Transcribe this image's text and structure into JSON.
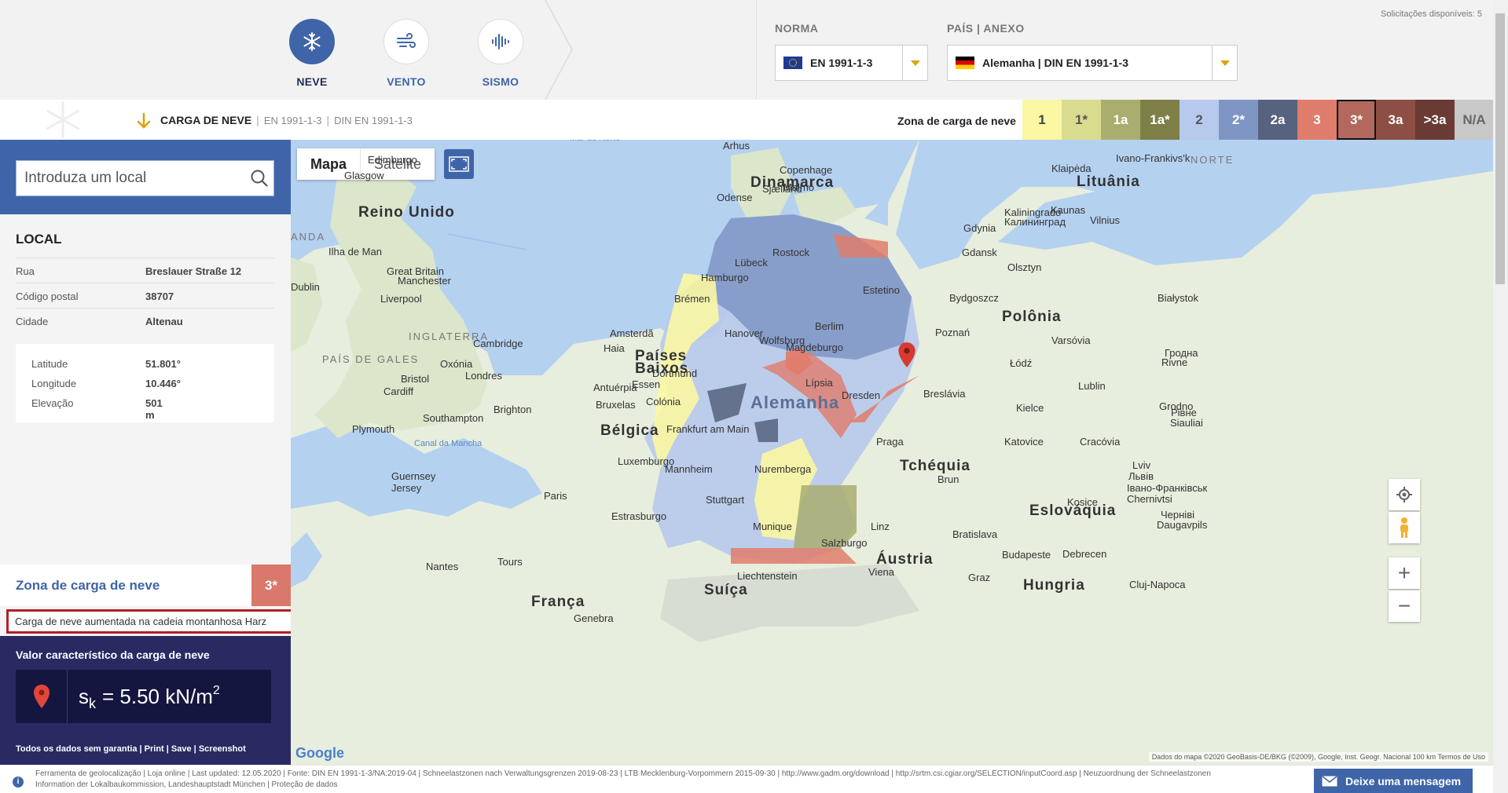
{
  "header": {
    "modes": [
      {
        "label": "NEVE",
        "icon": "snowflake-icon",
        "active": true
      },
      {
        "label": "VENTO",
        "icon": "wind-icon",
        "active": false
      },
      {
        "label": "SISMO",
        "icon": "seismic-icon",
        "active": false
      }
    ],
    "norma": {
      "label": "NORMA",
      "value": "EN 1991-1-3",
      "flag": "eu-flag-icon"
    },
    "pais": {
      "label": "PAÍS | ANEXO",
      "value": "Alemanha | DIN EN 1991-1-3",
      "flag": "germany-flag-icon"
    },
    "requests": "Solicitações disponíveis: 5"
  },
  "subheader": {
    "title": "CARGA DE NEVE",
    "std1": "EN 1991-1-3",
    "std2": "DIN EN 1991-1-3",
    "legend_title": "Zona de carga de neve",
    "zones": [
      {
        "label": "1",
        "color": "#fbf7a3",
        "text": "#444"
      },
      {
        "label": "1*",
        "color": "#d9dc8e",
        "text": "#555"
      },
      {
        "label": "1a",
        "color": "#a9ad6e",
        "text": "#fff"
      },
      {
        "label": "1a*",
        "color": "#7d7f47",
        "text": "#fff"
      },
      {
        "label": "2",
        "color": "#b7c9ec",
        "text": "#555"
      },
      {
        "label": "2*",
        "color": "#7f95c4",
        "text": "#fff"
      },
      {
        "label": "2a",
        "color": "#56627e",
        "text": "#fff"
      },
      {
        "label": "3",
        "color": "#e07c6b",
        "text": "#fff"
      },
      {
        "label": "3*",
        "color": "#b2685c",
        "text": "#fff",
        "selected": true
      },
      {
        "label": "3a",
        "color": "#8d4f45",
        "text": "#fff"
      },
      {
        "label": ">3a",
        "color": "#6a3b35",
        "text": "#fff"
      },
      {
        "label": "N/A",
        "color": "#c8c8c8",
        "text": "#666"
      }
    ]
  },
  "sidebar": {
    "search_placeholder": "Introduza um local",
    "local_title": "LOCAL",
    "address": [
      {
        "k": "Rua",
        "v": "Breslauer Straße 12"
      },
      {
        "k": "Código postal",
        "v": "38707"
      },
      {
        "k": "Cidade",
        "v": "Altenau"
      }
    ],
    "geo": [
      {
        "k": "Latitude",
        "v": "51.801°"
      },
      {
        "k": "Longitude",
        "v": "10.446°"
      },
      {
        "k": "Elevação",
        "v": "501 m"
      }
    ],
    "zone_label": "Zona de carga de neve",
    "zone_value": "3*",
    "zone_note": "Carga de neve aumentada na cadeia montanhosa Harz",
    "value_title": "Valor característico da carga de neve",
    "value_symbol": "s",
    "value_sub": "k",
    "value_text": "= 5.50 kN/m",
    "value_sup": "2",
    "links": {
      "prefix": "Todos os dados sem garantia",
      "print": "Print",
      "save": "Save",
      "screenshot": "Screenshot"
    }
  },
  "map": {
    "tab_map": "Mapa",
    "tab_sat": "Satélite",
    "google": "Google",
    "attribution": "Dados do mapa ©2020 GeoBasis-DE/BKG (©2009), Google, Inst. Geogr. Nacional   100 km   Termos de Uso",
    "labels": [
      {
        "t": "Mar do Norte",
        "c": "sea"
      },
      {
        "t": "Dinamarca",
        "c": "country"
      },
      {
        "t": "Reino Unido",
        "c": "country"
      },
      {
        "t": "Países",
        "c": "country"
      },
      {
        "t": "Baixos",
        "c": "country"
      },
      {
        "t": "Bélgica",
        "c": "country"
      },
      {
        "t": "Alemanha",
        "c": "country big"
      },
      {
        "t": "Polônia",
        "c": "country"
      },
      {
        "t": "Lituânia",
        "c": "country"
      },
      {
        "t": "Tchéquia",
        "c": "country"
      },
      {
        "t": "Eslováquia",
        "c": "country"
      },
      {
        "t": "Áustria",
        "c": "country"
      },
      {
        "t": "Hungria",
        "c": "country"
      },
      {
        "t": "Suíça",
        "c": "country"
      },
      {
        "t": "França",
        "c": "country"
      },
      {
        "t": "Liechtenstein",
        "c": "city"
      },
      {
        "t": "INGLATERRA",
        "c": "region"
      },
      {
        "t": "PAÍS DE GALES",
        "c": "region"
      },
      {
        "t": "Ilha de Man",
        "c": "city"
      },
      {
        "t": "Edimburgo",
        "c": "city"
      },
      {
        "t": "Glasgow",
        "c": "city"
      },
      {
        "t": "Dublin",
        "c": "city"
      },
      {
        "t": "Liverpool",
        "c": "city"
      },
      {
        "t": "Manchester",
        "c": "city"
      },
      {
        "t": "Londres",
        "c": "city"
      },
      {
        "t": "Bristol",
        "c": "city"
      },
      {
        "t": "Cardiff",
        "c": "city"
      },
      {
        "t": "Plymouth",
        "c": "city"
      },
      {
        "t": "Brighton",
        "c": "city"
      },
      {
        "t": "Southampton",
        "c": "city"
      },
      {
        "t": "Cambridge",
        "c": "city"
      },
      {
        "t": "Oxónia",
        "c": "city"
      },
      {
        "t": "Great Britain",
        "c": "city"
      },
      {
        "t": "Canal da Mancha",
        "c": "sea"
      },
      {
        "t": "Guernsey",
        "c": "city"
      },
      {
        "t": "Jersey",
        "c": "city"
      },
      {
        "t": "Amsterdã",
        "c": "city"
      },
      {
        "t": "Haia",
        "c": "city"
      },
      {
        "t": "Antuérpia",
        "c": "city"
      },
      {
        "t": "Bruxelas",
        "c": "city"
      },
      {
        "t": "Luxemburgo",
        "c": "city"
      },
      {
        "t": "Paris",
        "c": "city"
      },
      {
        "t": "Estrasburgo",
        "c": "city"
      },
      {
        "t": "Nantes",
        "c": "city"
      },
      {
        "t": "Tours",
        "c": "city"
      },
      {
        "t": "Genebra",
        "c": "city"
      },
      {
        "t": "Arhus",
        "c": "city"
      },
      {
        "t": "Copenhage",
        "c": "city"
      },
      {
        "t": "Malmö",
        "c": "city"
      },
      {
        "t": "Odense",
        "c": "city"
      },
      {
        "t": "Sjælland",
        "c": "city"
      },
      {
        "t": "Hamburgo",
        "c": "city"
      },
      {
        "t": "Brémen",
        "c": "city"
      },
      {
        "t": "Hanover",
        "c": "city"
      },
      {
        "t": "Wolfsburg",
        "c": "city"
      },
      {
        "t": "Magdeburgo",
        "c": "city"
      },
      {
        "t": "Berlim",
        "c": "city"
      },
      {
        "t": "Lípsia",
        "c": "city"
      },
      {
        "t": "Dresden",
        "c": "city"
      },
      {
        "t": "Dortmund",
        "c": "city"
      },
      {
        "t": "Essen",
        "c": "city"
      },
      {
        "t": "Colónia",
        "c": "city"
      },
      {
        "t": "Frankfurt am Main",
        "c": "city"
      },
      {
        "t": "Nuremberga",
        "c": "city"
      },
      {
        "t": "Stuttgart",
        "c": "city"
      },
      {
        "t": "Munique",
        "c": "city"
      },
      {
        "t": "Mannheim",
        "c": "city"
      },
      {
        "t": "Salzburgo",
        "c": "city"
      },
      {
        "t": "Rostock",
        "c": "city"
      },
      {
        "t": "Lübeck",
        "c": "city"
      },
      {
        "t": "Estetino",
        "c": "city"
      },
      {
        "t": "Gdynia",
        "c": "city"
      },
      {
        "t": "Gdansk",
        "c": "city"
      },
      {
        "t": "Klaipėda",
        "c": "city"
      },
      {
        "t": "Kaliningrado",
        "c": "city"
      },
      {
        "t": "Калининград",
        "c": "city"
      },
      {
        "t": "Kaunas",
        "c": "city"
      },
      {
        "t": "Vilnius",
        "c": "city"
      },
      {
        "t": "Olsztyn",
        "c": "city"
      },
      {
        "t": "Bydgoszcz",
        "c": "city"
      },
      {
        "t": "Poznań",
        "c": "city"
      },
      {
        "t": "Varsóvia",
        "c": "city"
      },
      {
        "t": "Białystok",
        "c": "city"
      },
      {
        "t": "Łódź",
        "c": "city"
      },
      {
        "t": "Breslávia",
        "c": "city"
      },
      {
        "t": "Lublin",
        "c": "city"
      },
      {
        "t": "Kielce",
        "c": "city"
      },
      {
        "t": "Cracóvia",
        "c": "city"
      },
      {
        "t": "Katovice",
        "c": "city"
      },
      {
        "t": "Praga",
        "c": "city"
      },
      {
        "t": "Brun",
        "c": "city"
      },
      {
        "t": "Linz",
        "c": "city"
      },
      {
        "t": "Viena",
        "c": "city"
      },
      {
        "t": "Bratislava",
        "c": "city"
      },
      {
        "t": "Graz",
        "c": "city"
      },
      {
        "t": "Budapeste",
        "c": "city"
      },
      {
        "t": "Kosice",
        "c": "city"
      },
      {
        "t": "Debrecen",
        "c": "city"
      },
      {
        "t": "Cluj-Napoca",
        "c": "city"
      },
      {
        "t": "Lviv",
        "c": "city"
      },
      {
        "t": "Львів",
        "c": "city"
      },
      {
        "t": "Grodno",
        "c": "city"
      },
      {
        "t": "Гродна",
        "c": "city"
      },
      {
        "t": "Rivne",
        "c": "city"
      },
      {
        "t": "Рівне",
        "c": "city"
      },
      {
        "t": "Siauliai",
        "c": "city"
      },
      {
        "t": "Ivano-Frankivs'k",
        "c": "city"
      },
      {
        "t": "Івано-Франківськ",
        "c": "city"
      },
      {
        "t": "Chernivtsi",
        "c": "city"
      },
      {
        "t": "Черніві",
        "c": "city"
      },
      {
        "t": "Daugavpils",
        "c": "city"
      },
      {
        "t": "NORTE",
        "c": "region"
      },
      {
        "t": "ANDA",
        "c": "region"
      }
    ]
  },
  "footer": {
    "line1": "Ferramenta de geolocalização  |  Loja online  |  Last updated: 12.05.2020  |  Fonte: DIN EN 1991-1-3/NA:2019-04  |  Schneelastzonen nach Verwaltungsgrenzen 2019-08-23  |  LTB Mecklenburg-Vorpommern 2015-09-30  |  http://www.gadm.org/download  |  http://srtm.csi.cgiar.org/SELECTION/inputCoord.asp  |  Neuzuordnung der Schneelastzonen",
    "line2": "Information der Lokalbaukommission, Landeshauptstadt München  |  Proteção de dados",
    "message": "Deixe uma mensagem"
  }
}
